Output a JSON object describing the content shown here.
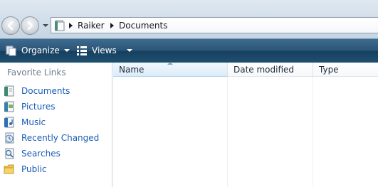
{
  "address": {
    "crumbs": [
      "Raiker",
      "Documents"
    ]
  },
  "toolbar": {
    "organize_label": "Organize",
    "views_label": "Views"
  },
  "left_pane": {
    "heading": "Favorite Links",
    "items": [
      {
        "label": "Documents",
        "icon": "documents-icon"
      },
      {
        "label": "Pictures",
        "icon": "pictures-icon"
      },
      {
        "label": "Music",
        "icon": "music-icon"
      },
      {
        "label": "Recently Changed",
        "icon": "recently-changed-icon"
      },
      {
        "label": "Searches",
        "icon": "searches-icon"
      },
      {
        "label": "Public",
        "icon": "public-folder-icon"
      }
    ]
  },
  "file_list": {
    "columns": [
      {
        "label": "Name",
        "sorted": true
      },
      {
        "label": "Date modified",
        "sorted": false
      },
      {
        "label": "Type",
        "sorted": false
      }
    ]
  },
  "colors": {
    "toolbar_top": "#3e6b8f",
    "toolbar_bottom": "#17405f",
    "link_text": "#1a5cb5",
    "heading_text": "#6d7f92"
  }
}
